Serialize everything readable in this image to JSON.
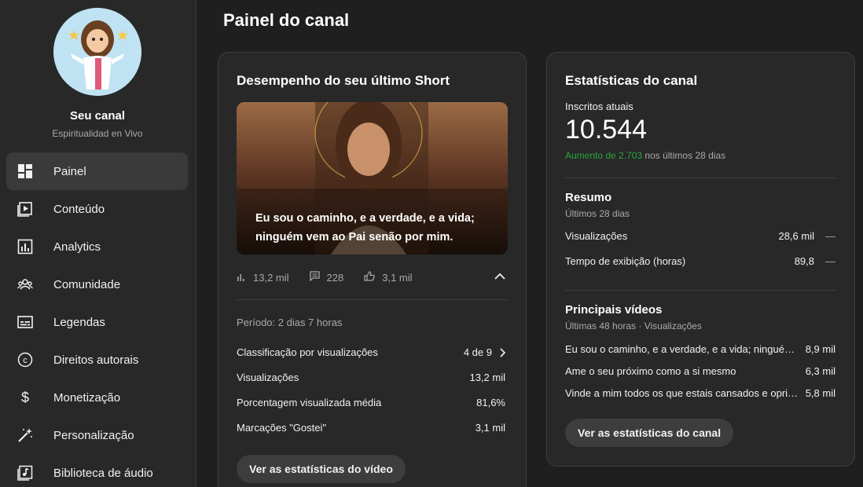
{
  "sidebar": {
    "channel_title": "Seu canal",
    "channel_name": "Espiritualidad en Vivo",
    "items": [
      {
        "label": "Painel",
        "icon": "dashboard-icon"
      },
      {
        "label": "Conteúdo",
        "icon": "content-icon"
      },
      {
        "label": "Analytics",
        "icon": "analytics-icon"
      },
      {
        "label": "Comunidade",
        "icon": "community-icon"
      },
      {
        "label": "Legendas",
        "icon": "subtitles-icon"
      },
      {
        "label": "Direitos autorais",
        "icon": "copyright-icon"
      },
      {
        "label": "Monetização",
        "icon": "dollar-icon"
      },
      {
        "label": "Personalização",
        "icon": "magic-wand-icon"
      },
      {
        "label": "Biblioteca de áudio",
        "icon": "audio-library-icon"
      }
    ]
  },
  "page_title": "Painel do canal",
  "short_card": {
    "title": "Desempenho do seu último Short",
    "thumbnail_caption": "Eu sou o caminho, e a verdade, e a vida; ninguém vem ao Pai senão por mim.",
    "views": "13,2 mil",
    "comments": "228",
    "likes": "3,1 mil",
    "period": "Período: 2 dias 7 horas",
    "rows": [
      {
        "label": "Classificação por visualizações",
        "value": "4 de 9"
      },
      {
        "label": "Visualizações",
        "value": "13,2 mil"
      },
      {
        "label": "Porcentagem visualizada média",
        "value": "81,6%"
      },
      {
        "label": "Marcações \"Gostei\"",
        "value": "3,1 mil"
      }
    ],
    "button": "Ver as estatísticas do vídeo"
  },
  "stats_card": {
    "title": "Estatísticas do canal",
    "subs_label": "Inscritos atuais",
    "subs_value": "10.544",
    "growth_up": "Aumento de 2.703",
    "growth_rest": " nos últimos 28 dias",
    "summary_title": "Resumo",
    "summary_sub": "Últimos 28 dias",
    "summary_rows": [
      {
        "label": "Visualizações",
        "value": "28,6 mil",
        "trend": "—"
      },
      {
        "label": "Tempo de exibição (horas)",
        "value": "89,8",
        "trend": "—"
      }
    ],
    "top_title": "Principais vídeos",
    "top_sub": "Últimas 48 horas · Visualizações",
    "top_videos": [
      {
        "title": "Eu sou o caminho, e a verdade, e a vida; ninguém vem ao Pai senão por mim.",
        "views": "8,9 mil"
      },
      {
        "title": "Ame o seu próximo como a si mesmo",
        "views": "6,3 mil"
      },
      {
        "title": "Vinde a mim todos os que estais cansados e oprimidos",
        "views": "5,8 mil"
      }
    ],
    "button": "Ver as estatísticas do canal"
  },
  "colors": {
    "accent_growth": "#2ba640",
    "background": "#1f1f1f",
    "card": "#282828"
  }
}
